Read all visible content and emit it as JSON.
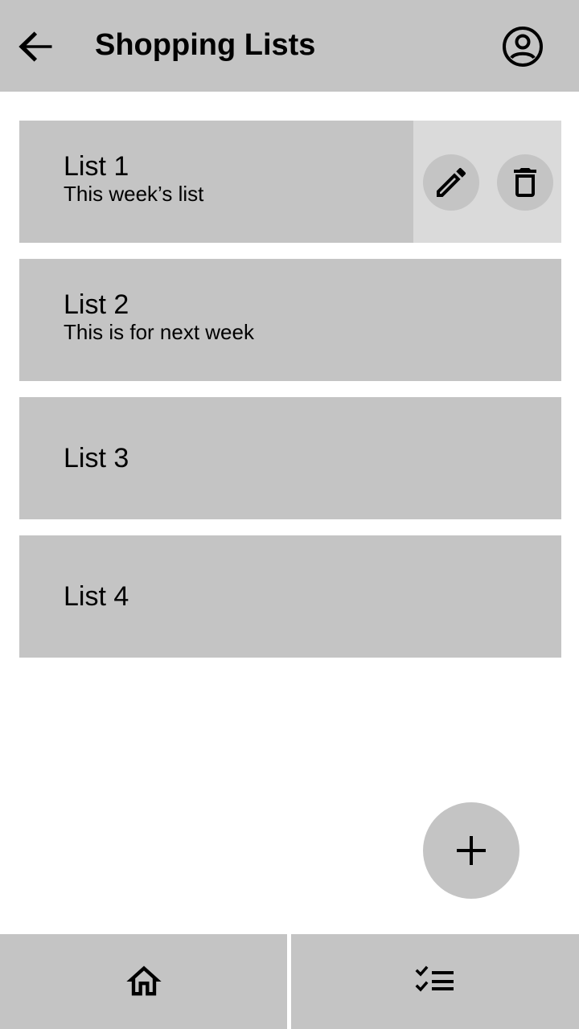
{
  "appbar": {
    "title": "Shopping Lists",
    "back_icon": "arrow-left-icon",
    "profile_icon": "account-circle-icon"
  },
  "lists": [
    {
      "name": "List 1",
      "description": "This week’s list",
      "actions_revealed": true
    },
    {
      "name": "List 2",
      "description": "This is for next week"
    },
    {
      "name": "List 3"
    },
    {
      "name": "List 4"
    }
  ],
  "card_actions": {
    "edit_icon": "pencil-icon",
    "delete_icon": "trash-icon"
  },
  "fab": {
    "icon": "plus-icon"
  },
  "bottom_nav": [
    {
      "icon": "home-icon"
    },
    {
      "icon": "checklist-icon"
    }
  ],
  "colors": {
    "surface": "#c4c4c4",
    "action_panel": "#dadada",
    "background": "#ffffff",
    "text": "#000000"
  }
}
